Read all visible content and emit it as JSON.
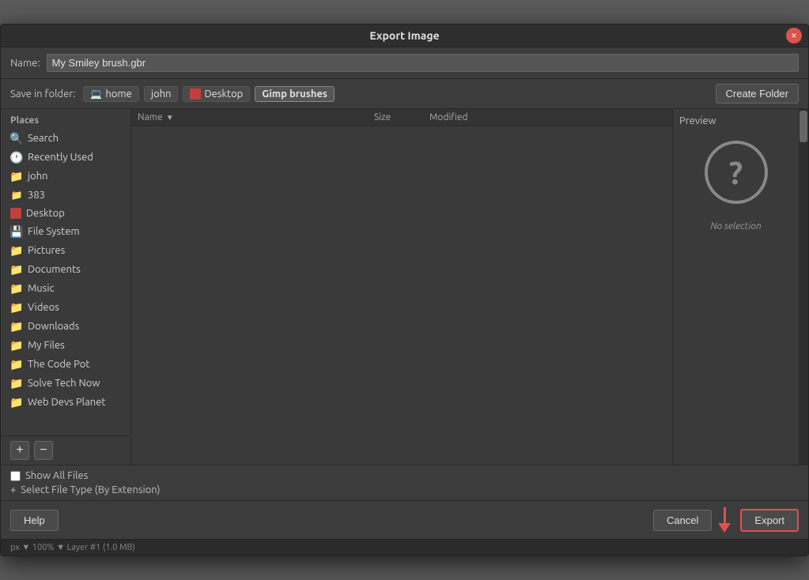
{
  "dialog": {
    "title": "Export Image",
    "close_label": "×"
  },
  "name_row": {
    "label": "Name:",
    "value": "My Smiley brush.gbr"
  },
  "folder_row": {
    "label": "Save in folder:",
    "breadcrumbs": [
      {
        "id": "home-crumb",
        "label": "home",
        "icon": "computer"
      },
      {
        "id": "john-crumb",
        "label": "john",
        "icon": "none"
      },
      {
        "id": "desktop-crumb",
        "label": "Desktop",
        "icon": "desktop"
      },
      {
        "id": "gimpbrushes-crumb",
        "label": "Gimp brushes",
        "icon": "none",
        "active": true
      }
    ],
    "create_folder_label": "Create Folder"
  },
  "sidebar": {
    "header": "Places",
    "items": [
      {
        "id": "search",
        "label": "Search",
        "icon": "🔍",
        "type": "special"
      },
      {
        "id": "recently-used",
        "label": "Recently Used",
        "icon": "🕐",
        "type": "special"
      },
      {
        "id": "john",
        "label": "john",
        "icon": "📁",
        "type": "folder"
      },
      {
        "id": "383",
        "label": "383",
        "icon": "📁",
        "type": "folder"
      },
      {
        "id": "desktop",
        "label": "Desktop",
        "icon": "🖥️",
        "type": "special"
      },
      {
        "id": "filesystem",
        "label": "File System",
        "icon": "💾",
        "type": "special"
      },
      {
        "id": "pictures",
        "label": "Pictures",
        "icon": "📁",
        "type": "folder"
      },
      {
        "id": "documents",
        "label": "Documents",
        "icon": "📁",
        "type": "folder"
      },
      {
        "id": "music",
        "label": "Music",
        "icon": "📁",
        "type": "folder"
      },
      {
        "id": "videos",
        "label": "Videos",
        "icon": "📁",
        "type": "folder"
      },
      {
        "id": "downloads",
        "label": "Downloads",
        "icon": "📁",
        "type": "folder"
      },
      {
        "id": "myfiles",
        "label": "My Files",
        "icon": "📁",
        "type": "folder"
      },
      {
        "id": "thecodepot",
        "label": "The Code Pot",
        "icon": "📁",
        "type": "folder"
      },
      {
        "id": "solvetechnow",
        "label": "Solve Tech Now",
        "icon": "📁",
        "type": "folder"
      },
      {
        "id": "webdevsplanet",
        "label": "Web Devs Planet",
        "icon": "📁",
        "type": "folder"
      }
    ],
    "add_button": "+",
    "remove_button": "−"
  },
  "file_table": {
    "columns": [
      {
        "id": "name",
        "label": "Name"
      },
      {
        "id": "size",
        "label": "Size"
      },
      {
        "id": "modified",
        "label": "Modified"
      }
    ],
    "rows": []
  },
  "preview": {
    "header": "Preview",
    "no_selection_text": "No selection"
  },
  "bottom_options": {
    "show_all_files_label": "Show All Files",
    "select_file_type_label": "Select File Type (By Extension)"
  },
  "actions": {
    "help_label": "Help",
    "cancel_label": "Cancel",
    "export_label": "Export"
  }
}
